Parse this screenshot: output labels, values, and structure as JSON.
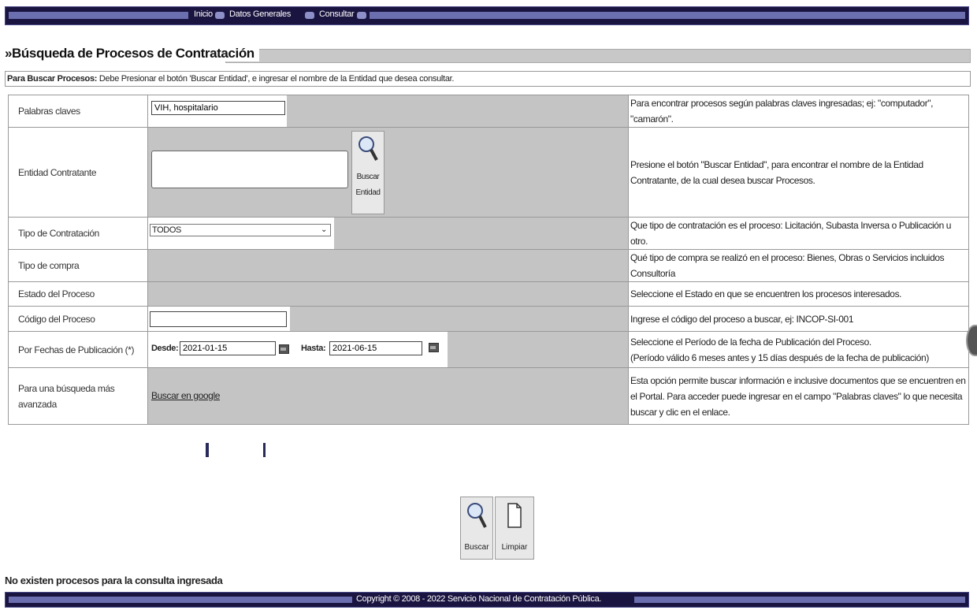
{
  "nav": {
    "items": [
      "Inicio",
      "Datos Generales",
      "Consultar"
    ]
  },
  "heading": "»Búsqueda de Procesos de Contratación",
  "instructions": {
    "bold": "Para Buscar Procesos:",
    "text": " Debe Presionar el botón 'Buscar Entidad', e ingresar el nombre de la Entidad que desea consultar."
  },
  "rows": {
    "keywords": {
      "label": "Palabras claves",
      "value": "VIH, hospitalario",
      "help": "Para encontrar procesos según palabras claves ingresadas; ej: \"computador\", \"camarón\"."
    },
    "entity": {
      "label": "Entidad Contratante",
      "button_line1": "Buscar",
      "button_line2": "Entidad",
      "help": "Presione el botón \"Buscar Entidad\", para encontrar el nombre de la Entidad Contratante, de la cual desea buscar Procesos."
    },
    "type": {
      "label": "Tipo de Contratación",
      "selected": "TODOS",
      "help": "Que tipo de contratación es el proceso: Licitación, Subasta Inversa o Publicación u otro."
    },
    "purchase": {
      "label": "Tipo de compra",
      "help": "Qué tipo de compra se realizó en el proceso: Bienes, Obras o Servicios incluidos Consultoría"
    },
    "state": {
      "label": "Estado del Proceso",
      "help": "Seleccione el Estado en que se encuentren los procesos interesados."
    },
    "code": {
      "label": "Código del Proceso",
      "help": "Ingrese el código del proceso a buscar, ej: INCOP-SI-001"
    },
    "dates": {
      "label": "Por Fechas de Publicación (*)",
      "from_label": "Desde:",
      "from_value": "2021-01-15",
      "to_label": "Hasta:",
      "to_value": "2021-06-15",
      "help1": "Seleccione el Período de la fecha de Publicación del Proceso.",
      "help2": "(Período válido 6 meses antes y 15 días después de la fecha de publicación)"
    },
    "advanced": {
      "label": "Para una búsqueda más avanzada",
      "link": "Buscar en google",
      "help": "Esta opción permite buscar información e inclusive documentos que se encuentren en el Portal. Para acceder puede ingresar en el campo \"Palabras claves\" lo que necesita buscar y clic en el enlace."
    }
  },
  "actions": {
    "search": "Buscar",
    "clear": "Limpiar"
  },
  "no_results": "No existen procesos para la consulta ingresada",
  "footer": "Copyright © 2008 - 2022 Servicio Nacional de Contratación Pública."
}
